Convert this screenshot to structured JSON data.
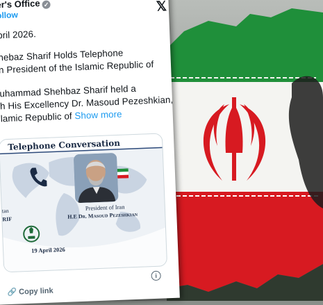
{
  "tweet": {
    "account_name": "er's Office",
    "follow_label": "ollow",
    "lines": [
      "pril 2026.",
      "hebaz Sharif Holds Telephone",
      "n President of the Islamic Republic of",
      "uhammad Shehbaz Sharif held a",
      "h His Excellency Dr. Masoud Pezeshkian,",
      "lamic Republic of"
    ],
    "show_more": "Show more",
    "copy_link": "Copy link"
  },
  "image_card": {
    "title": "Telephone Conversation",
    "left_partial_1": "tan",
    "left_partial_2": "RIF",
    "iran_role": "President of Iran",
    "iran_name": "H.E Dr. Masoud Pezeshkian",
    "date": "19 April 2026"
  },
  "icons": [
    "x-logo-icon",
    "verified-icon",
    "phone-icon",
    "info-icon",
    "link-icon"
  ],
  "colors": {
    "iran_green": "#1f8f3a",
    "iran_red": "#d71a21",
    "link_blue": "#1d9bf0"
  }
}
